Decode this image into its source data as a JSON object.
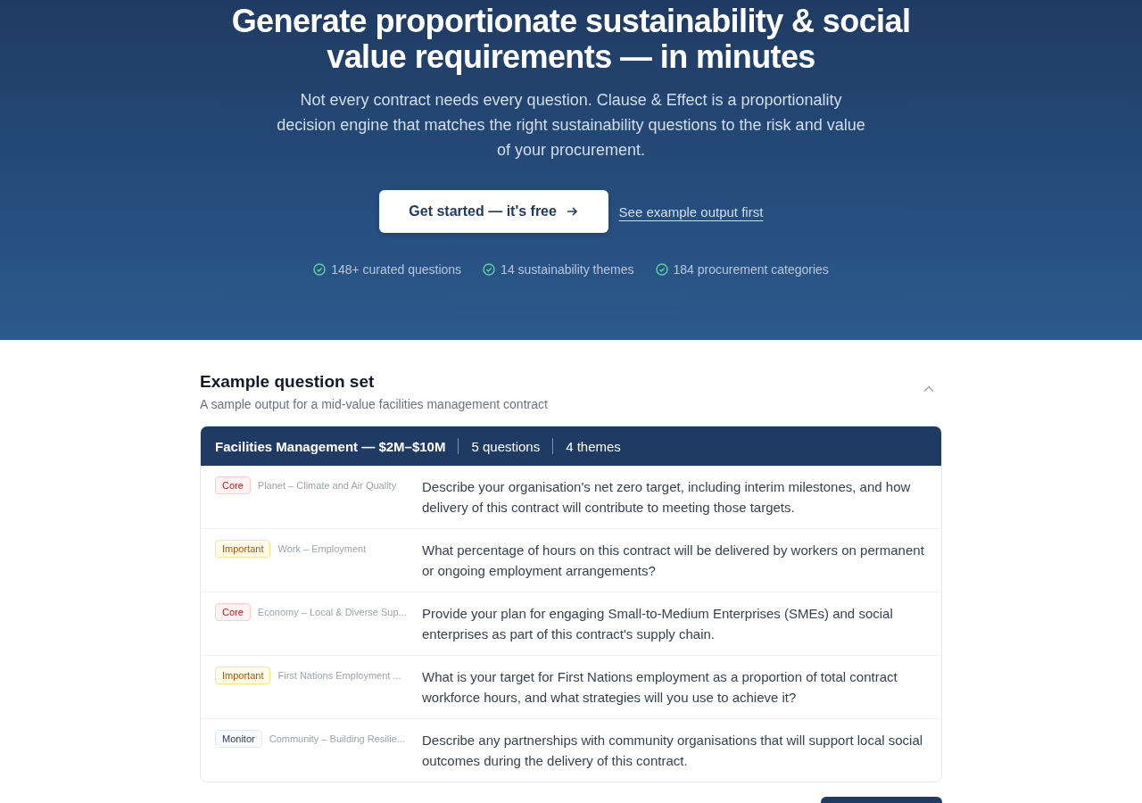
{
  "hero": {
    "title": "Generate proportionate sustainability & social value requirements — in minutes",
    "subtitle": "Not every contract needs every question. Clause & Effect is a proportionality decision engine that matches the right sustainability questions to the risk and value of your procurement.",
    "primary_button": "Get started — it's free",
    "secondary_link": "See example output first",
    "stats": [
      "148+ curated questions",
      "14 sustainability themes",
      "184 procurement categories"
    ]
  },
  "example": {
    "title": "Example question set",
    "subtitle": "A sample output for a mid-value facilities management contract",
    "expanded": true,
    "header": [
      "Facilities Management — $2M–$10M",
      "5 questions",
      "4 themes"
    ],
    "questions": [
      {
        "priority": "Core",
        "kind": "core",
        "theme": "Planet – Climate and Air Quality",
        "text": "Describe your organisation's net zero target, including interim milestones, and how delivery of this contract will contribute to meeting those targets."
      },
      {
        "priority": "Important",
        "kind": "important",
        "theme": "Work – Employment",
        "text": "What percentage of hours on this contract will be delivered by workers on permanent or ongoing employment arrangements?"
      },
      {
        "priority": "Core",
        "kind": "core",
        "theme": "Economy – Local & Diverse Sup...",
        "text": "Provide your plan for engaging Small-to-Medium Enterprises (SMEs) and social enterprises as part of this contract's supply chain."
      },
      {
        "priority": "Important",
        "kind": "important",
        "theme": "First Nations Employment ...",
        "text": "What is your target for First Nations employment as a proportion of total contract workforce hours, and what strategies will you use to achieve it?"
      },
      {
        "priority": "Monitor",
        "kind": "monitor",
        "theme": "Community – Building Resilie...",
        "text": "Describe any partnerships with community organisations that will support local social outcomes during the delivery of this contract."
      }
    ]
  }
}
